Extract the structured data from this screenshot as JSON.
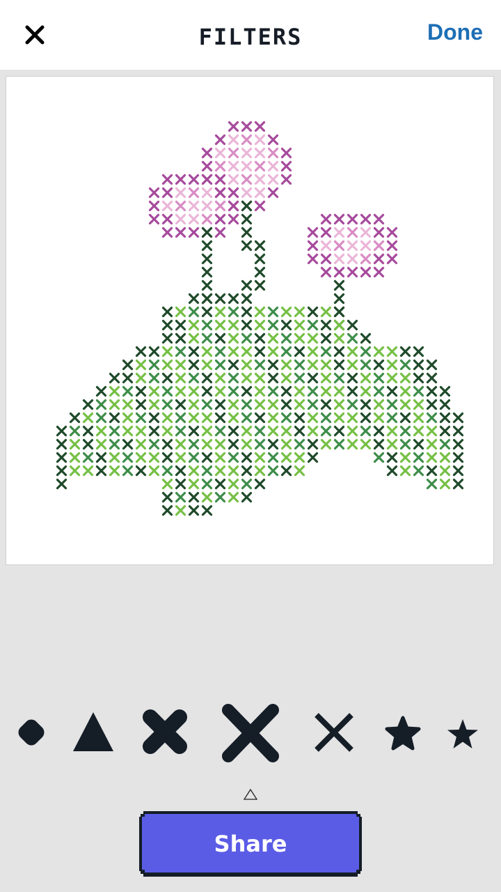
{
  "header": {
    "title": "FILTERS",
    "done_label": "Done",
    "close_icon": "close-icon"
  },
  "pattern": {
    "description_icon": "cross-stitch-pattern",
    "colors": {
      "stem_dark": "#1f4a2a",
      "leaf_light": "#76c046",
      "leaf_mid": "#3e8d4a",
      "flower_dark": "#a64a9c",
      "flower_light": "#eab6d8",
      "flower_mid": "#d98cc4"
    }
  },
  "stitch_shapes": [
    {
      "name": "circle-stitch-icon"
    },
    {
      "name": "triangle-stitch-icon"
    },
    {
      "name": "rounded-x-stitch-icon"
    },
    {
      "name": "large-x-stitch-icon"
    },
    {
      "name": "thin-x-stitch-icon"
    },
    {
      "name": "rounded-star-stitch-icon"
    },
    {
      "name": "star-stitch-icon"
    }
  ],
  "selected_indicator_icon": "triangle-up-icon",
  "share": {
    "label": "Share",
    "color": "#5b5ce6"
  }
}
